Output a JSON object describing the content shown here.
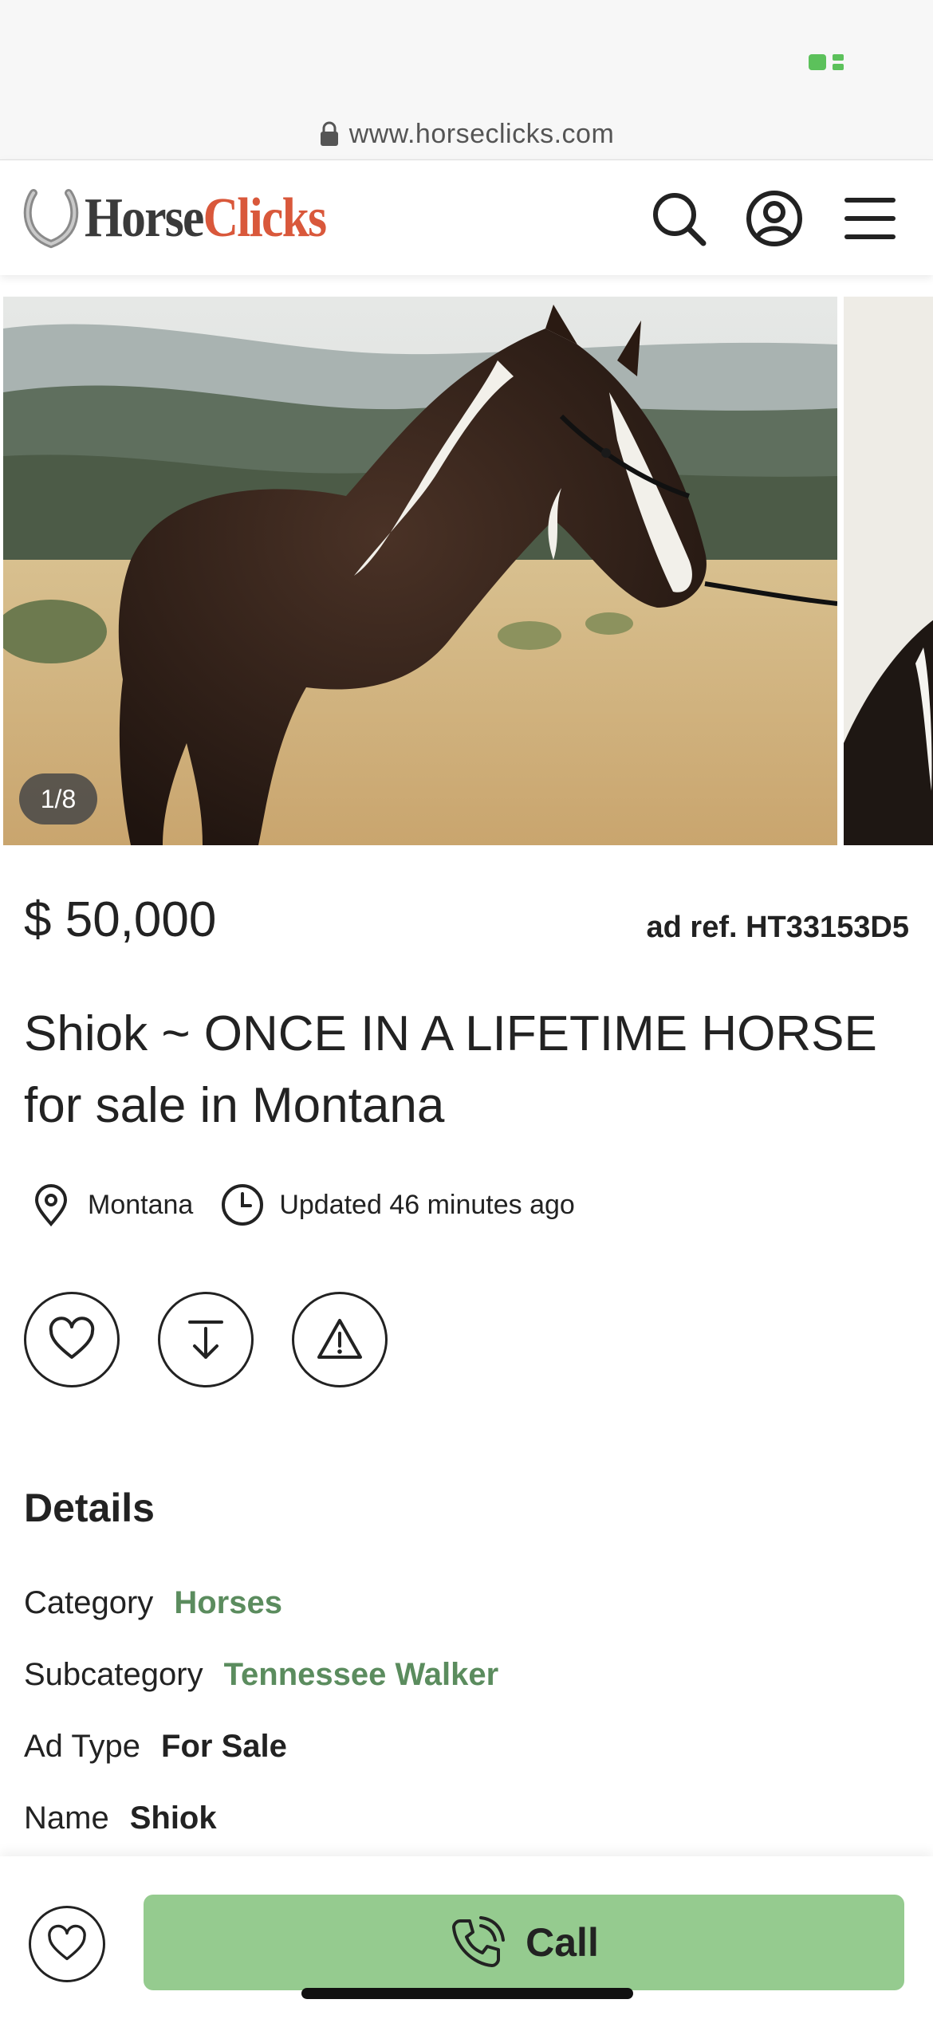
{
  "browser": {
    "url": "www.horseclicks.com"
  },
  "header": {
    "logo_part1": "Horse",
    "logo_part2": "Clicks",
    "icons": [
      "search-icon",
      "account-icon",
      "menu-icon"
    ]
  },
  "gallery": {
    "counter": "1/8"
  },
  "listing": {
    "price": "$ 50,000",
    "ad_ref": "ad ref. HT33153D5",
    "title": "Shiok ~ ONCE IN A LIFETIME HORSE for sale in Montana",
    "location": "Montana",
    "updated": "Updated 46 minutes ago"
  },
  "details": {
    "heading": "Details",
    "rows": [
      {
        "label": "Category",
        "value": "Horses"
      },
      {
        "label": "Subcategory",
        "value": "Tennessee Walker"
      },
      {
        "label": "Ad Type",
        "value": "For Sale"
      },
      {
        "label": "Name",
        "value": "Shiok"
      }
    ]
  },
  "bottom_bar": {
    "call_label": "Call"
  },
  "colors": {
    "brand_orange": "#d9583b",
    "link_green": "#5b8c5e",
    "call_green": "#95cb8f"
  }
}
